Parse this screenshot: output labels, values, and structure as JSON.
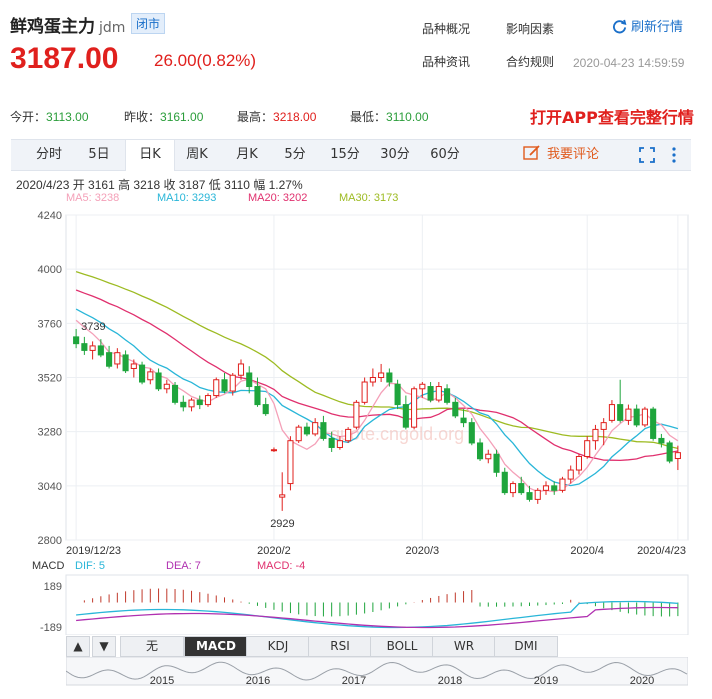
{
  "header": {
    "name": "鲜鸡蛋主力",
    "code": "jdm",
    "status": "闭市",
    "price": "3187.00",
    "change": "26.00(0.82%)",
    "links": [
      "品种概况",
      "影响因素",
      "品种资讯",
      "合约规则"
    ],
    "refresh_label": "刷新行情",
    "datetime": "2020-04-23 14:59:59"
  },
  "stats": {
    "open_label": "今开：",
    "open": "3113.00",
    "prev_label": "昨收：",
    "prev": "3161.00",
    "high_label": "最高：",
    "high": "3218.00",
    "low_label": "最低：",
    "low": "3110.00"
  },
  "promo": "打开APP查看完整行情",
  "tabs": [
    "分时",
    "5日",
    "日K",
    "周K",
    "月K",
    "5分",
    "15分",
    "30分",
    "60分"
  ],
  "active_tab": "日K",
  "comment_label": "我要评论",
  "info_line": "2020/4/23  开 3161  高 3218  收 3187  低 3110  幅 1.27%",
  "ma": {
    "ma5": "MA5: 3238",
    "ma10": "MA10: 3293",
    "ma20": "MA20: 3202",
    "ma30": "MA30: 3173",
    "colors": {
      "ma5": "#f4a0b8",
      "ma10": "#29b6d8",
      "ma20": "#e0306e",
      "ma30": "#9dbb22"
    }
  },
  "watermark": "quote.cngold.org",
  "indicator_buttons": [
    "无",
    "MACD",
    "KDJ",
    "RSI",
    "BOLL",
    "WR",
    "DMI"
  ],
  "active_indicator": "MACD",
  "chart_data": {
    "type": "candlestick",
    "ylim": [
      2800,
      4240
    ],
    "yticks": [
      "4240",
      "4000",
      "3760",
      "3520",
      "3280",
      "3040",
      "2800"
    ],
    "xticks": [
      "2019/12/23",
      "2020/2",
      "2020/3",
      "2020/4",
      "2020/4/23"
    ],
    "annotations": {
      "max": "3739",
      "min": "2929"
    },
    "candles": [
      [
        3700,
        3735,
        3650,
        3670
      ],
      [
        3670,
        3700,
        3620,
        3640
      ],
      [
        3640,
        3680,
        3600,
        3660
      ],
      [
        3660,
        3690,
        3610,
        3620
      ],
      [
        3630,
        3660,
        3560,
        3570
      ],
      [
        3580,
        3650,
        3560,
        3630
      ],
      [
        3620,
        3640,
        3540,
        3550
      ],
      [
        3560,
        3600,
        3520,
        3580
      ],
      [
        3575,
        3590,
        3490,
        3500
      ],
      [
        3510,
        3560,
        3490,
        3545
      ],
      [
        3540,
        3560,
        3460,
        3470
      ],
      [
        3470,
        3510,
        3450,
        3490
      ],
      [
        3485,
        3500,
        3400,
        3410
      ],
      [
        3410,
        3440,
        3370,
        3390
      ],
      [
        3390,
        3430,
        3370,
        3420
      ],
      [
        3420,
        3440,
        3380,
        3400
      ],
      [
        3400,
        3450,
        3390,
        3440
      ],
      [
        3440,
        3520,
        3430,
        3510
      ],
      [
        3510,
        3540,
        3450,
        3460
      ],
      [
        3460,
        3540,
        3440,
        3530
      ],
      [
        3530,
        3600,
        3510,
        3580
      ],
      [
        3540,
        3570,
        3450,
        3480
      ],
      [
        3480,
        3520,
        3390,
        3400
      ],
      [
        3400,
        3430,
        3350,
        3360
      ],
      [
        3200,
        3210,
        3190,
        3200
      ],
      [
        2990,
        3100,
        2929,
        3000
      ],
      [
        3050,
        3260,
        3020,
        3240
      ],
      [
        3240,
        3310,
        3230,
        3300
      ],
      [
        3300,
        3320,
        3260,
        3270
      ],
      [
        3270,
        3340,
        3260,
        3320
      ],
      [
        3320,
        3350,
        3240,
        3250
      ],
      [
        3250,
        3280,
        3190,
        3210
      ],
      [
        3210,
        3260,
        3200,
        3240
      ],
      [
        3240,
        3300,
        3230,
        3290
      ],
      [
        3300,
        3420,
        3290,
        3410
      ],
      [
        3410,
        3520,
        3400,
        3500
      ],
      [
        3500,
        3560,
        3480,
        3520
      ],
      [
        3520,
        3580,
        3500,
        3540
      ],
      [
        3540,
        3560,
        3480,
        3500
      ],
      [
        3490,
        3510,
        3380,
        3400
      ],
      [
        3400,
        3440,
        3290,
        3300
      ],
      [
        3300,
        3480,
        3290,
        3470
      ],
      [
        3470,
        3500,
        3430,
        3490
      ],
      [
        3480,
        3500,
        3410,
        3420
      ],
      [
        3420,
        3500,
        3410,
        3480
      ],
      [
        3470,
        3490,
        3400,
        3410
      ],
      [
        3410,
        3430,
        3340,
        3350
      ],
      [
        3340,
        3380,
        3300,
        3320
      ],
      [
        3320,
        3340,
        3220,
        3230
      ],
      [
        3230,
        3250,
        3150,
        3160
      ],
      [
        3160,
        3200,
        3140,
        3180
      ],
      [
        3180,
        3200,
        3080,
        3100
      ],
      [
        3100,
        3120,
        3000,
        3010
      ],
      [
        3010,
        3060,
        2990,
        3050
      ],
      [
        3050,
        3080,
        3000,
        3010
      ],
      [
        3010,
        3040,
        2970,
        2980
      ],
      [
        2980,
        3030,
        2960,
        3020
      ],
      [
        3020,
        3060,
        3000,
        3040
      ],
      [
        3040,
        3060,
        3000,
        3020
      ],
      [
        3020,
        3080,
        3010,
        3070
      ],
      [
        3070,
        3130,
        3050,
        3110
      ],
      [
        3110,
        3180,
        3090,
        3170
      ],
      [
        3170,
        3260,
        3160,
        3240
      ],
      [
        3240,
        3310,
        3200,
        3290
      ],
      [
        3290,
        3340,
        3220,
        3320
      ],
      [
        3330,
        3420,
        3320,
        3400
      ],
      [
        3400,
        3510,
        3320,
        3330
      ],
      [
        3330,
        3400,
        3310,
        3380
      ],
      [
        3380,
        3400,
        3300,
        3310
      ],
      [
        3310,
        3390,
        3300,
        3380
      ],
      [
        3380,
        3390,
        3240,
        3250
      ],
      [
        3250,
        3270,
        3210,
        3230
      ],
      [
        3230,
        3240,
        3140,
        3150
      ],
      [
        3161,
        3218,
        3110,
        3187
      ]
    ],
    "macd": {
      "ylim": [
        -189,
        189
      ],
      "yticks": [
        "189",
        "-189"
      ],
      "labels": [
        "MACD",
        "DIF: 5",
        "DEA: 7",
        "MACD: -4"
      ]
    }
  },
  "timeline": {
    "years": [
      "2015",
      "2016",
      "2017",
      "2018",
      "2019",
      "2020"
    ]
  }
}
